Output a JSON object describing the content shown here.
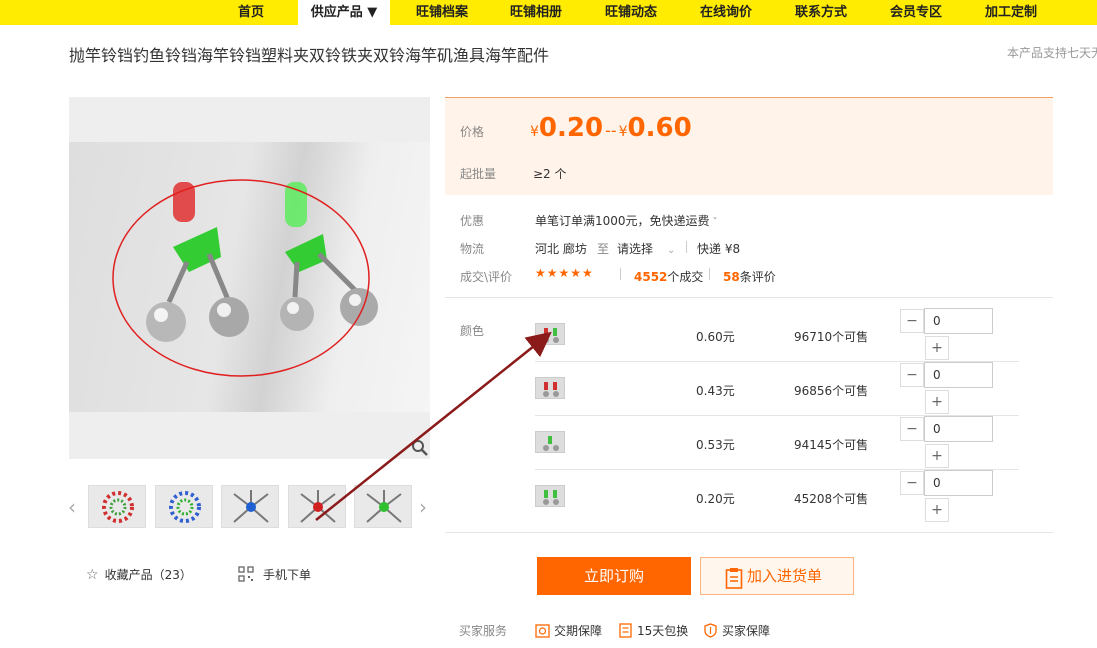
{
  "nav": {
    "items": [
      "首页",
      "供应产品 ▼",
      "旺铺档案",
      "旺铺相册",
      "旺铺动态",
      "在线询价",
      "联系方式",
      "会员专区",
      "加工定制"
    ]
  },
  "product": {
    "title": "抛竿铃铛钓鱼铃铛海竿铃铛塑料夹双铃铁夹双铃海竿矶渔具海竿配件",
    "support_note": "本产品支持七天无"
  },
  "price": {
    "label": "价格",
    "currency": "¥",
    "low": "0.20",
    "sep": "--",
    "high": "0.60",
    "moq_label": "起批量",
    "moq_value": "≥2 个"
  },
  "promo": {
    "label": "优惠",
    "value": "单笔订单满1000元，免快递运费"
  },
  "logistics": {
    "label": "物流",
    "origin": "河北 廊坊",
    "to": "至",
    "dest": "请选择",
    "shipping": "快递 ¥8"
  },
  "deals": {
    "label": "成交\\评价",
    "stars": "★★★★★",
    "count": "4552",
    "count_suffix": "个成交",
    "reviews": "58",
    "reviews_suffix": "条评价"
  },
  "sku": {
    "label": "颜色",
    "rows": [
      {
        "price": "0.60元",
        "stock": "96710个可售",
        "qty": "0"
      },
      {
        "price": "0.43元",
        "stock": "96856个可售",
        "qty": "0"
      },
      {
        "price": "0.53元",
        "stock": "94145个可售",
        "qty": "0"
      },
      {
        "price": "0.20元",
        "stock": "45208个可售",
        "qty": "0"
      }
    ],
    "minus": "−",
    "plus": "+"
  },
  "actions": {
    "order": "立即订购",
    "cart": "加入进货单"
  },
  "left": {
    "fav": "收藏产品（23）",
    "mobile": "手机下单"
  },
  "services": {
    "label": "买家服务",
    "items": [
      "交期保障",
      "15天包换",
      "买家保障"
    ]
  },
  "colors": {
    "accent": "#ff6600",
    "nav_bg": "#ffec00",
    "price_bg": "#fff3ea"
  }
}
